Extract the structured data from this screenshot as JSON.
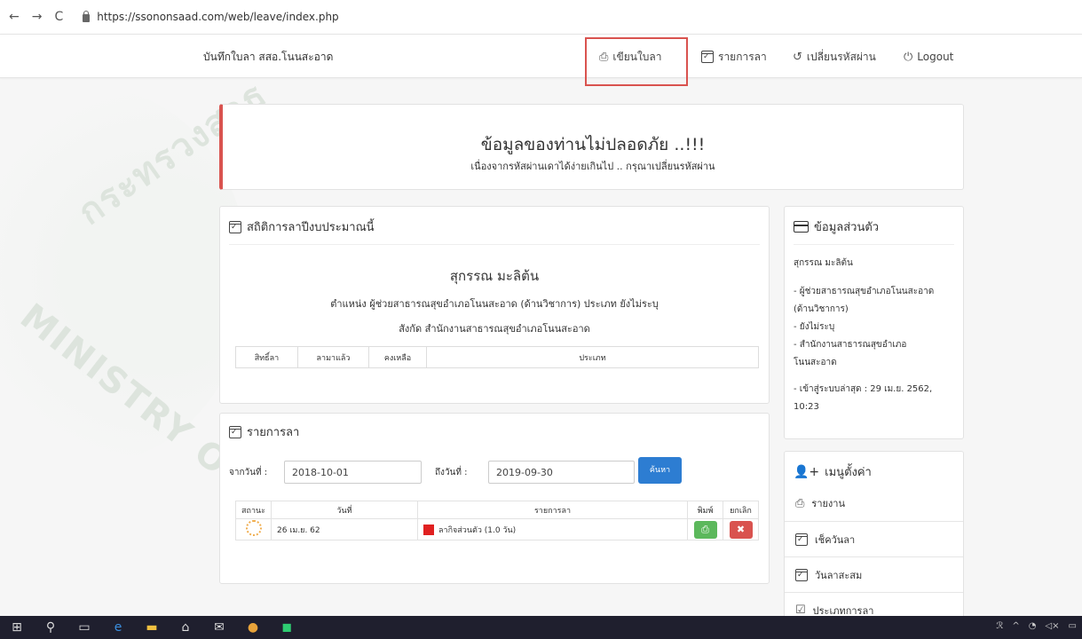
{
  "browser": {
    "url": "https://ssononsaad.com/web/leave/index.php"
  },
  "navbar": {
    "brand": "บันทึกใบลา สสอ.โนนสะอาด",
    "items": [
      {
        "label": "เขียนใบลา",
        "icon": "printer-icon"
      },
      {
        "label": "รายการลา",
        "icon": "calendar-check-icon"
      },
      {
        "label": "เปลี่ยนรหัสผ่าน",
        "icon": "undo-icon"
      },
      {
        "label": "Logout",
        "icon": "power-icon"
      }
    ]
  },
  "watermark": {
    "text1": "กระทรวงสาธ",
    "text2": "MINISTRY OF P"
  },
  "alert": {
    "title": "ข้อมูลของท่านไม่ปลอดภัย ..!!!",
    "message": "เนื่องจากรหัสผ่านเดาได้ง่ายเกินไป .. กรุณาเปลี่ยนรหัสผ่าน",
    "accent": "#d9534f"
  },
  "stats": {
    "heading": "สถิติการลาปีงบประมาณนี้",
    "name": "สุกรรณ มะลิต้น",
    "position_line": "ตำแหน่ง ผู้ช่วยสาธารณสุขอำเภอโนนสะอาด (ด้านวิชาการ)  ประเภท ยังไม่ระบุ",
    "office_line": "สังกัด สำนักงานสาธารณสุขอำเภอโนนสะอาด",
    "columns": [
      "สิทธิ์ลา",
      "ลามาแล้ว",
      "คงเหลือ",
      "ประเภท"
    ]
  },
  "leave_list": {
    "heading": "รายการลา",
    "from_label": "จากวันที่ :",
    "from_value": "2018-10-01",
    "to_label": "ถึงวันที่ :",
    "to_value": "2019-09-30",
    "search_label": "ค้นหา",
    "columns": [
      "สถานะ",
      "วันที่",
      "รายการลา",
      "พิมพ์",
      "ยกเลิก"
    ],
    "rows": [
      {
        "date": "26 เม.ย. 62",
        "item": "ลากิจส่วนตัว (1.0 วัน)",
        "status_icon": "loading-icon"
      }
    ]
  },
  "profile": {
    "heading": "ข้อมูลส่วนตัว",
    "name": "สุกรรณ มะลิต้น",
    "pos1": "- ผู้ช่วยสาธารณสุขอำเภอโนนสะอาด",
    "pos2": "(ด้านวิชาการ)",
    "type": "- ยังไม่ระบุ",
    "office1": "- สำนักงานสาธารณสุขอำเภอ",
    "office2": "โนนสะอาด",
    "login1": "- เข้าสู่ระบบล่าสุด : 29 เม.ย. 2562,",
    "login2": "10:23"
  },
  "settings": {
    "heading": "เมนูตั้งค่า",
    "items": [
      "รายงาน",
      "เช็ควันลา",
      "วันลาสะสม",
      "ประเภทการลา"
    ]
  },
  "colors": {
    "primary": "#2d7dd2",
    "success": "#5cb85c",
    "danger": "#d9534f",
    "taskbar": "#1f1f2e"
  }
}
